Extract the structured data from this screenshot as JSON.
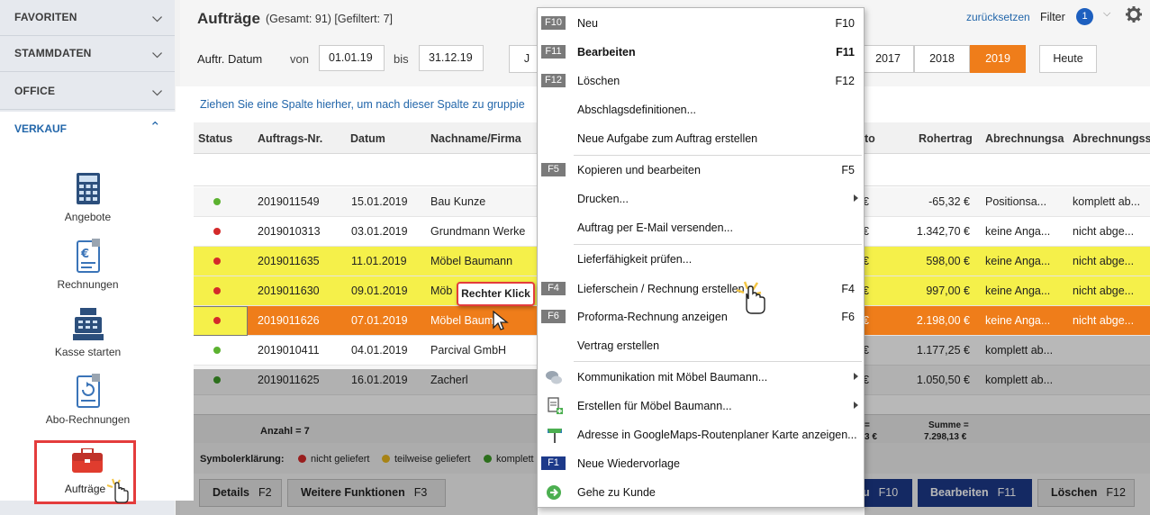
{
  "sidebar": {
    "sections": [
      "FAVORITEN",
      "STAMMDATEN",
      "OFFICE"
    ],
    "active_section": "VERKAUF",
    "items": [
      {
        "label": "Angebote",
        "icon": "calculator-icon"
      },
      {
        "label": "Rechnungen",
        "icon": "euro-document-icon"
      },
      {
        "label": "Kasse starten",
        "icon": "cash-register-icon"
      },
      {
        "label": "Abo-Rechnungen",
        "icon": "recurring-document-icon"
      },
      {
        "label": "Aufträge",
        "icon": "briefcase-icon"
      }
    ]
  },
  "header": {
    "title": "Aufträge",
    "subtitle": "(Gesamt: 91) [Gefiltert: 7]",
    "reset": "zurücksetzen",
    "filter": "Filter",
    "filter_count": "1"
  },
  "datefilter": {
    "label": "Auftr. Datum",
    "from_label": "von",
    "from": "01.01.19",
    "to_label": "bis",
    "to": "31.12.19",
    "partial_btn": "J",
    "years": [
      "2017",
      "2018",
      "2019"
    ],
    "active_year": "2019",
    "today": "Heute"
  },
  "grid": {
    "group_hint": "Ziehen Sie eine Spalte hierher, um nach dieser Spalte zu gruppie",
    "columns": [
      "Status",
      "Auftrags-Nr.",
      "Datum",
      "Nachname/Firma",
      "to",
      "Rohertrag",
      "Abrechnungsa",
      "Abrechnungss"
    ],
    "rows": [
      {
        "status": "green",
        "nr": "2019011549",
        "datum": "15.01.2019",
        "name": "Bau Kunze",
        "e": "€",
        "rohertrag": "-65,32 €",
        "a1": "Positionsa...",
        "a2": "komplett ab..."
      },
      {
        "status": "red",
        "nr": "2019010313",
        "datum": "03.01.2019",
        "name": "Grundmann Werke",
        "e": "€",
        "rohertrag": "1.342,70 €",
        "a1": "keine Anga...",
        "a2": "nicht abge..."
      },
      {
        "status": "red",
        "nr": "2019011635",
        "datum": "11.01.2019",
        "name": "Möbel Baumann",
        "e": "€",
        "rohertrag": "598,00 €",
        "a1": "keine Anga...",
        "a2": "nicht abge..."
      },
      {
        "status": "red",
        "nr": "2019011630",
        "datum": "09.01.2019",
        "name": "Möb",
        "e": "€",
        "rohertrag": "997,00 €",
        "a1": "keine Anga...",
        "a2": "nicht abge..."
      },
      {
        "status": "red",
        "nr": "2019011626",
        "datum": "07.01.2019",
        "name": "Möbel Baum",
        "e": "€",
        "rohertrag": "2.198,00 €",
        "a1": "keine Anga...",
        "a2": "nicht abge..."
      },
      {
        "status": "green",
        "nr": "2019010411",
        "datum": "04.01.2019",
        "name": "Parcival GmbH",
        "e": "€",
        "rohertrag": "1.177,25 €",
        "a1": "komplett ab...",
        "a2": ""
      },
      {
        "status": "green",
        "nr": "2019011625",
        "datum": "16.01.2019",
        "name": "Zacherl",
        "e": "€",
        "rohertrag": "1.050,50 €",
        "a1": "komplett ab...",
        "a2": ""
      }
    ],
    "count": "Anzahl = 7",
    "sum_left_a": "=",
    "sum_left_b": "3 €",
    "sum_label": "Summe =",
    "sum_value": "7.298,13 €"
  },
  "legend": {
    "title": "Symbolerklärung:",
    "red": "nicht geliefert",
    "yellow": "teilweise geliefert",
    "green": "komplett"
  },
  "bottom": {
    "details": "Details",
    "details_key": "F2",
    "more": "Weitere Funktionen",
    "more_key": "F3",
    "new_partial": "u",
    "new_key": "F10",
    "edit": "Bearbeiten",
    "edit_key": "F11",
    "delete": "Löschen",
    "delete_key": "F12"
  },
  "menu": {
    "items": [
      {
        "key": "F10",
        "label": "Neu",
        "shortcut": "F10"
      },
      {
        "key": "F11",
        "label": "Bearbeiten",
        "shortcut": "F11"
      },
      {
        "key": "F12",
        "label": "Löschen",
        "shortcut": "F12"
      },
      {
        "label": "Abschlagsdefinitionen..."
      },
      {
        "label": "Neue Aufgabe zum Auftrag erstellen"
      },
      {
        "key": "F5",
        "label": "Kopieren und bearbeiten",
        "shortcut": "F5"
      },
      {
        "label": "Drucken..."
      },
      {
        "label": "Auftrag per E-Mail versenden..."
      },
      {
        "label": "Lieferfähigkeit prüfen..."
      },
      {
        "key": "F4",
        "label": "Lieferschein / Rechnung erstellen",
        "shortcut": "F4"
      },
      {
        "key": "F6",
        "label": "Proforma-Rechnung anzeigen",
        "shortcut": "F6"
      },
      {
        "label": "Vertrag erstellen"
      },
      {
        "label": "Kommunikation mit Möbel Baumann..."
      },
      {
        "label": "Erstellen für Möbel Baumann..."
      },
      {
        "label": "Adresse in GoogleMaps-Routenplaner Karte anzeigen..."
      },
      {
        "key": "F1",
        "label": "Neue Wiedervorlage"
      },
      {
        "label": "Gehe zu Kunde"
      }
    ]
  },
  "tooltip": "Rechter Klick",
  "colors": {
    "accent": "#ef7d1a",
    "sidebar_blue": "#2266aa",
    "highlight_yellow": "#f5f04a",
    "dark_blue": "#1d3a8a"
  }
}
